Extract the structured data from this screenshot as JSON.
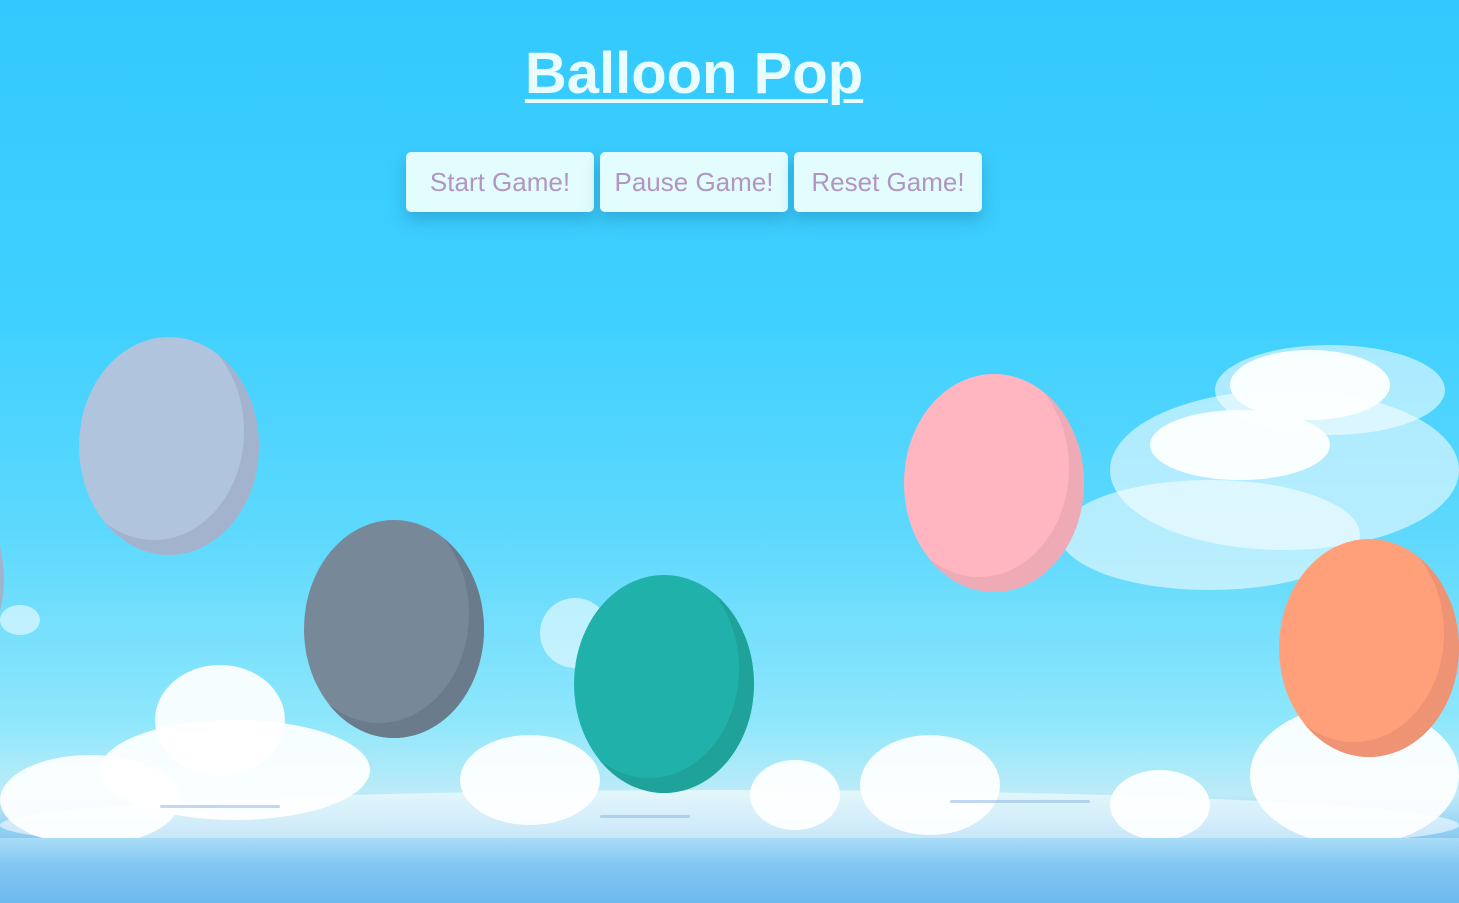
{
  "game": {
    "title": "Balloon Pop"
  },
  "controls": {
    "start_label": "Start Game!",
    "pause_label": "Pause Game!",
    "reset_label": "Reset Game!"
  },
  "balloons": [
    {
      "color": "lightsteelblue",
      "fill": "#b0c4de",
      "shade": "#a4b3cd"
    },
    {
      "color": "lightslategray",
      "fill": "#778899",
      "shade": "#6a7b8b"
    },
    {
      "color": "lightseagreen",
      "fill": "#20b2aa",
      "shade": "#1ea299"
    },
    {
      "color": "lightpink",
      "fill": "#ffb6c1",
      "shade": "#eeaab5"
    },
    {
      "color": "lightsalmon",
      "fill": "#ffa07a",
      "shade": "#ee9373"
    },
    {
      "color": "partial-left",
      "fill": "#b0c4de",
      "shade": "#a4b3cd"
    }
  ]
}
